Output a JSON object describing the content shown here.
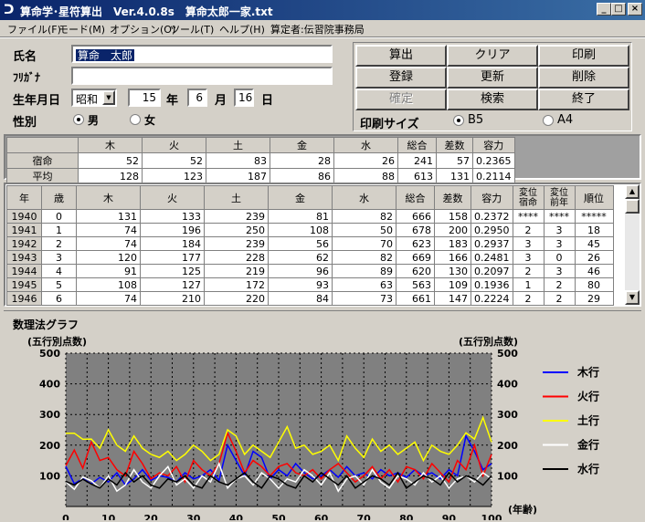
{
  "window": {
    "title": "算命学･星符算出　Ver.4.0.8s　算命太郎一家.txt",
    "min": "_",
    "max": "□",
    "close": "×"
  },
  "menu": {
    "items": [
      "ファイル(F)",
      "モード(M)",
      "オプション(O)",
      "ツール(T)",
      "ヘルプ(H)"
    ],
    "author": "算定者:伝習院事務局"
  },
  "form": {
    "name_label": "氏名",
    "name_value": "算命　太郎",
    "furigana_label": "ﾌﾘｶﾞﾅ",
    "furigana_value": "",
    "birth_label": "生年月日",
    "era": "昭和",
    "year": "15",
    "year_unit": "年",
    "month": "6",
    "month_unit": "月",
    "day": "16",
    "day_unit": "日",
    "gender_label": "性別",
    "male": "男",
    "female": "女",
    "gender_selected": "男"
  },
  "buttons": {
    "calc": "算出",
    "clear": "クリア",
    "print": "印刷",
    "register": "登録",
    "update": "更新",
    "delete": "削除",
    "confirm": "確定",
    "search": "検索",
    "exit": "終了"
  },
  "print_size": {
    "label": "印刷サイズ",
    "b5": "B5",
    "a4": "A4",
    "selected": "B5"
  },
  "summary_table": {
    "headers": [
      "",
      "木",
      "火",
      "土",
      "金",
      "水",
      "総合",
      "差数",
      "容力"
    ],
    "rows": [
      [
        "宿命",
        "52",
        "52",
        "83",
        "28",
        "26",
        "241",
        "57",
        "0.2365"
      ],
      [
        "平均",
        "128",
        "123",
        "187",
        "86",
        "88",
        "613",
        "131",
        "0.2114"
      ]
    ]
  },
  "yearly_table": {
    "headers": [
      "年",
      "歳",
      "木",
      "火",
      "土",
      "金",
      "水",
      "総合",
      "差数",
      "容力",
      "変位宿命",
      "変位前年",
      "順位"
    ],
    "rows": [
      [
        "1940",
        "0",
        "131",
        "133",
        "239",
        "81",
        "82",
        "666",
        "158",
        "0.2372",
        "****",
        "****",
        "*****"
      ],
      [
        "1941",
        "1",
        "74",
        "196",
        "250",
        "108",
        "50",
        "678",
        "200",
        "0.2950",
        "2",
        "3",
        "18"
      ],
      [
        "1942",
        "2",
        "74",
        "184",
        "239",
        "56",
        "70",
        "623",
        "183",
        "0.2937",
        "3",
        "3",
        "45"
      ],
      [
        "1943",
        "3",
        "120",
        "177",
        "228",
        "62",
        "82",
        "669",
        "166",
        "0.2481",
        "3",
        "0",
        "26"
      ],
      [
        "1944",
        "4",
        "91",
        "125",
        "219",
        "96",
        "89",
        "620",
        "130",
        "0.2097",
        "2",
        "3",
        "46"
      ],
      [
        "1945",
        "5",
        "108",
        "127",
        "172",
        "93",
        "63",
        "563",
        "109",
        "0.1936",
        "1",
        "2",
        "80"
      ],
      [
        "1946",
        "6",
        "74",
        "210",
        "220",
        "84",
        "73",
        "661",
        "147",
        "0.2224",
        "2",
        "2",
        "29"
      ]
    ]
  },
  "graph": {
    "title": "数理法グラフ",
    "left_unit": "(五行別点数)",
    "right_unit": "(五行別点数)",
    "x_unit": "(年齢)"
  },
  "chart_data": {
    "type": "line",
    "title": "数理法グラフ",
    "xlabel": "(年齢)",
    "ylabel": "(五行別点数)",
    "xlim": [
      0,
      100
    ],
    "ylim": [
      0,
      500
    ],
    "x_ticks": [
      0,
      10,
      20,
      30,
      40,
      50,
      60,
      70,
      80,
      90,
      100
    ],
    "y_ticks": [
      100,
      200,
      300,
      400,
      500
    ],
    "grid": true,
    "legend_position": "right",
    "series": [
      {
        "name": "木行",
        "color": "#0000ff",
        "x": [
          0,
          2,
          4,
          6,
          8,
          10,
          12,
          14,
          16,
          18,
          20,
          22,
          24,
          26,
          28,
          30,
          32,
          34,
          36,
          38,
          40,
          42,
          44,
          46,
          48,
          50,
          52,
          54,
          56,
          58,
          60,
          62,
          64,
          66,
          68,
          70,
          72,
          74,
          76,
          78,
          80,
          82,
          84,
          86,
          88,
          90,
          92,
          94,
          96,
          98,
          100
        ],
        "values": [
          131,
          74,
          91,
          74,
          95,
          80,
          110,
          70,
          90,
          120,
          85,
          100,
          95,
          80,
          110,
          90,
          100,
          120,
          85,
          200,
          150,
          100,
          180,
          160,
          90,
          120,
          100,
          140,
          110,
          90,
          100,
          120,
          95,
          130,
          100,
          110,
          90,
          120,
          100,
          110,
          95,
          120,
          100,
          110,
          90,
          120,
          100,
          230,
          180,
          120,
          140
        ]
      },
      {
        "name": "火行",
        "color": "#ff0000",
        "x": [
          0,
          2,
          4,
          6,
          8,
          10,
          12,
          14,
          16,
          18,
          20,
          22,
          24,
          26,
          28,
          30,
          32,
          34,
          36,
          38,
          40,
          42,
          44,
          46,
          48,
          50,
          52,
          54,
          56,
          58,
          60,
          62,
          64,
          66,
          68,
          70,
          72,
          74,
          76,
          78,
          80,
          82,
          84,
          86,
          88,
          90,
          92,
          94,
          96,
          98,
          100
        ],
        "values": [
          133,
          184,
          125,
          210,
          150,
          160,
          120,
          100,
          180,
          140,
          90,
          110,
          100,
          130,
          80,
          150,
          120,
          100,
          140,
          240,
          180,
          110,
          150,
          130,
          100,
          130,
          140,
          110,
          100,
          120,
          90,
          120,
          140,
          110,
          80,
          100,
          130,
          90,
          120,
          80,
          130,
          120,
          90,
          140,
          110,
          80,
          150,
          120,
          200,
          100,
          170
        ]
      },
      {
        "name": "土行",
        "color": "#ffff00",
        "x": [
          0,
          2,
          4,
          6,
          8,
          10,
          12,
          14,
          16,
          18,
          20,
          22,
          24,
          26,
          28,
          30,
          32,
          34,
          36,
          38,
          40,
          42,
          44,
          46,
          48,
          50,
          52,
          54,
          56,
          58,
          60,
          62,
          64,
          66,
          68,
          70,
          72,
          74,
          76,
          78,
          80,
          82,
          84,
          86,
          88,
          90,
          92,
          94,
          96,
          98,
          100
        ],
        "values": [
          239,
          239,
          219,
          220,
          190,
          250,
          200,
          180,
          230,
          190,
          170,
          160,
          180,
          150,
          170,
          200,
          180,
          150,
          170,
          250,
          230,
          170,
          200,
          180,
          160,
          210,
          260,
          190,
          200,
          170,
          180,
          200,
          150,
          230,
          190,
          160,
          220,
          180,
          200,
          170,
          190,
          210,
          150,
          200,
          180,
          170,
          200,
          240,
          220,
          290,
          210
        ]
      },
      {
        "name": "金行",
        "color": "#ffffff",
        "x": [
          0,
          2,
          4,
          6,
          8,
          10,
          12,
          14,
          16,
          18,
          20,
          22,
          24,
          26,
          28,
          30,
          32,
          34,
          36,
          38,
          40,
          42,
          44,
          46,
          48,
          50,
          52,
          54,
          56,
          58,
          60,
          62,
          64,
          66,
          68,
          70,
          72,
          74,
          76,
          78,
          80,
          82,
          84,
          86,
          88,
          90,
          92,
          94,
          96,
          98,
          100
        ],
        "values": [
          81,
          56,
          96,
          84,
          60,
          100,
          50,
          70,
          120,
          80,
          60,
          100,
          130,
          70,
          90,
          60,
          100,
          80,
          140,
          60,
          90,
          100,
          70,
          110,
          90,
          60,
          90,
          80,
          120,
          100,
          70,
          110,
          50,
          90,
          100,
          70,
          120,
          80,
          60,
          100,
          90,
          70,
          110,
          80,
          100,
          60,
          90,
          100,
          80,
          110,
          90
        ]
      },
      {
        "name": "水行",
        "color": "#000000",
        "x": [
          0,
          2,
          4,
          6,
          8,
          10,
          12,
          14,
          16,
          18,
          20,
          22,
          24,
          26,
          28,
          30,
          32,
          34,
          36,
          38,
          40,
          42,
          44,
          46,
          48,
          50,
          52,
          54,
          56,
          58,
          60,
          62,
          64,
          66,
          68,
          70,
          72,
          74,
          76,
          78,
          80,
          82,
          84,
          86,
          88,
          90,
          92,
          94,
          96,
          98,
          100
        ],
        "values": [
          82,
          70,
          89,
          73,
          60,
          90,
          70,
          110,
          80,
          100,
          70,
          60,
          90,
          80,
          100,
          70,
          60,
          100,
          80,
          70,
          90,
          110,
          80,
          60,
          100,
          90,
          70,
          60,
          100,
          80,
          110,
          90,
          70,
          100,
          60,
          80,
          100,
          90,
          70,
          110,
          60,
          80,
          100,
          90,
          70,
          110,
          80,
          100,
          90,
          70,
          100
        ]
      }
    ]
  }
}
